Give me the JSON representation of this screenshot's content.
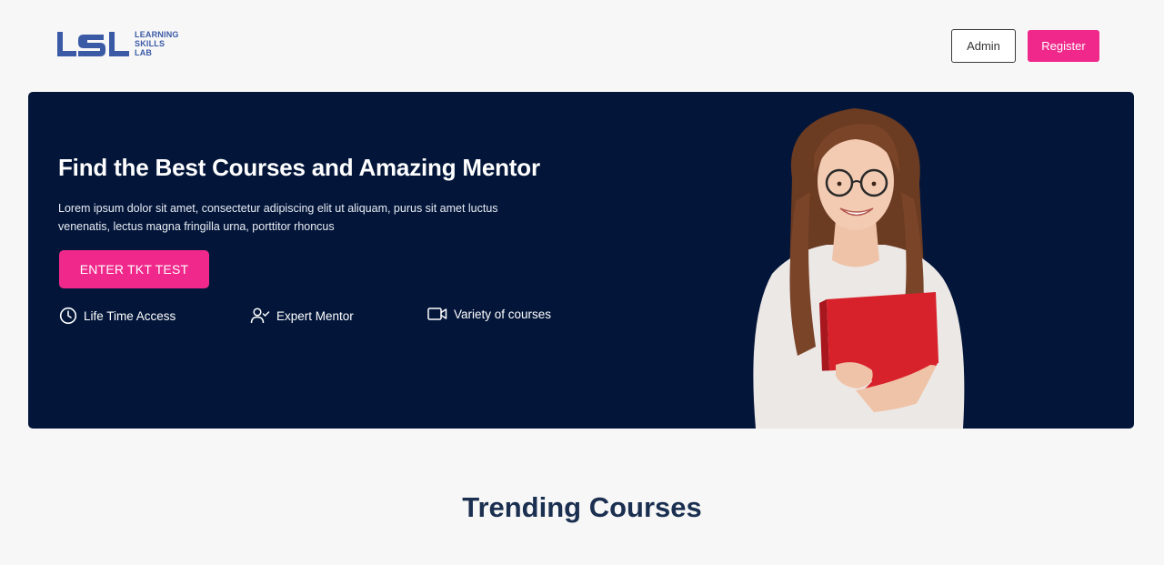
{
  "header": {
    "logo": {
      "mark": "LSL",
      "lines": [
        "LEARNING",
        "SKILLS",
        "LAB"
      ]
    },
    "admin_label": "Admin",
    "register_label": "Register"
  },
  "hero": {
    "title": "Find the Best Courses and Amazing Mentor",
    "description": "Lorem ipsum dolor sit amet, consectetur adipiscing elit ut aliquam, purus sit amet luctus venenatis, lectus magna fringilla urna, porttitor rhoncus",
    "cta_label": "ENTER TKT TEST",
    "features": [
      {
        "icon": "clock-icon",
        "label": "Life Time Access"
      },
      {
        "icon": "user-check-icon",
        "label": "Expert Mentor"
      },
      {
        "icon": "video-icon",
        "label": "Variety of courses"
      }
    ]
  },
  "trending": {
    "title": "Trending Courses"
  },
  "colors": {
    "accent": "#f0288b",
    "hero_bg": "#03163a",
    "logo_blue": "#3b5aa6",
    "heading": "#1b2f50",
    "page_bg": "#f7f7f7"
  }
}
